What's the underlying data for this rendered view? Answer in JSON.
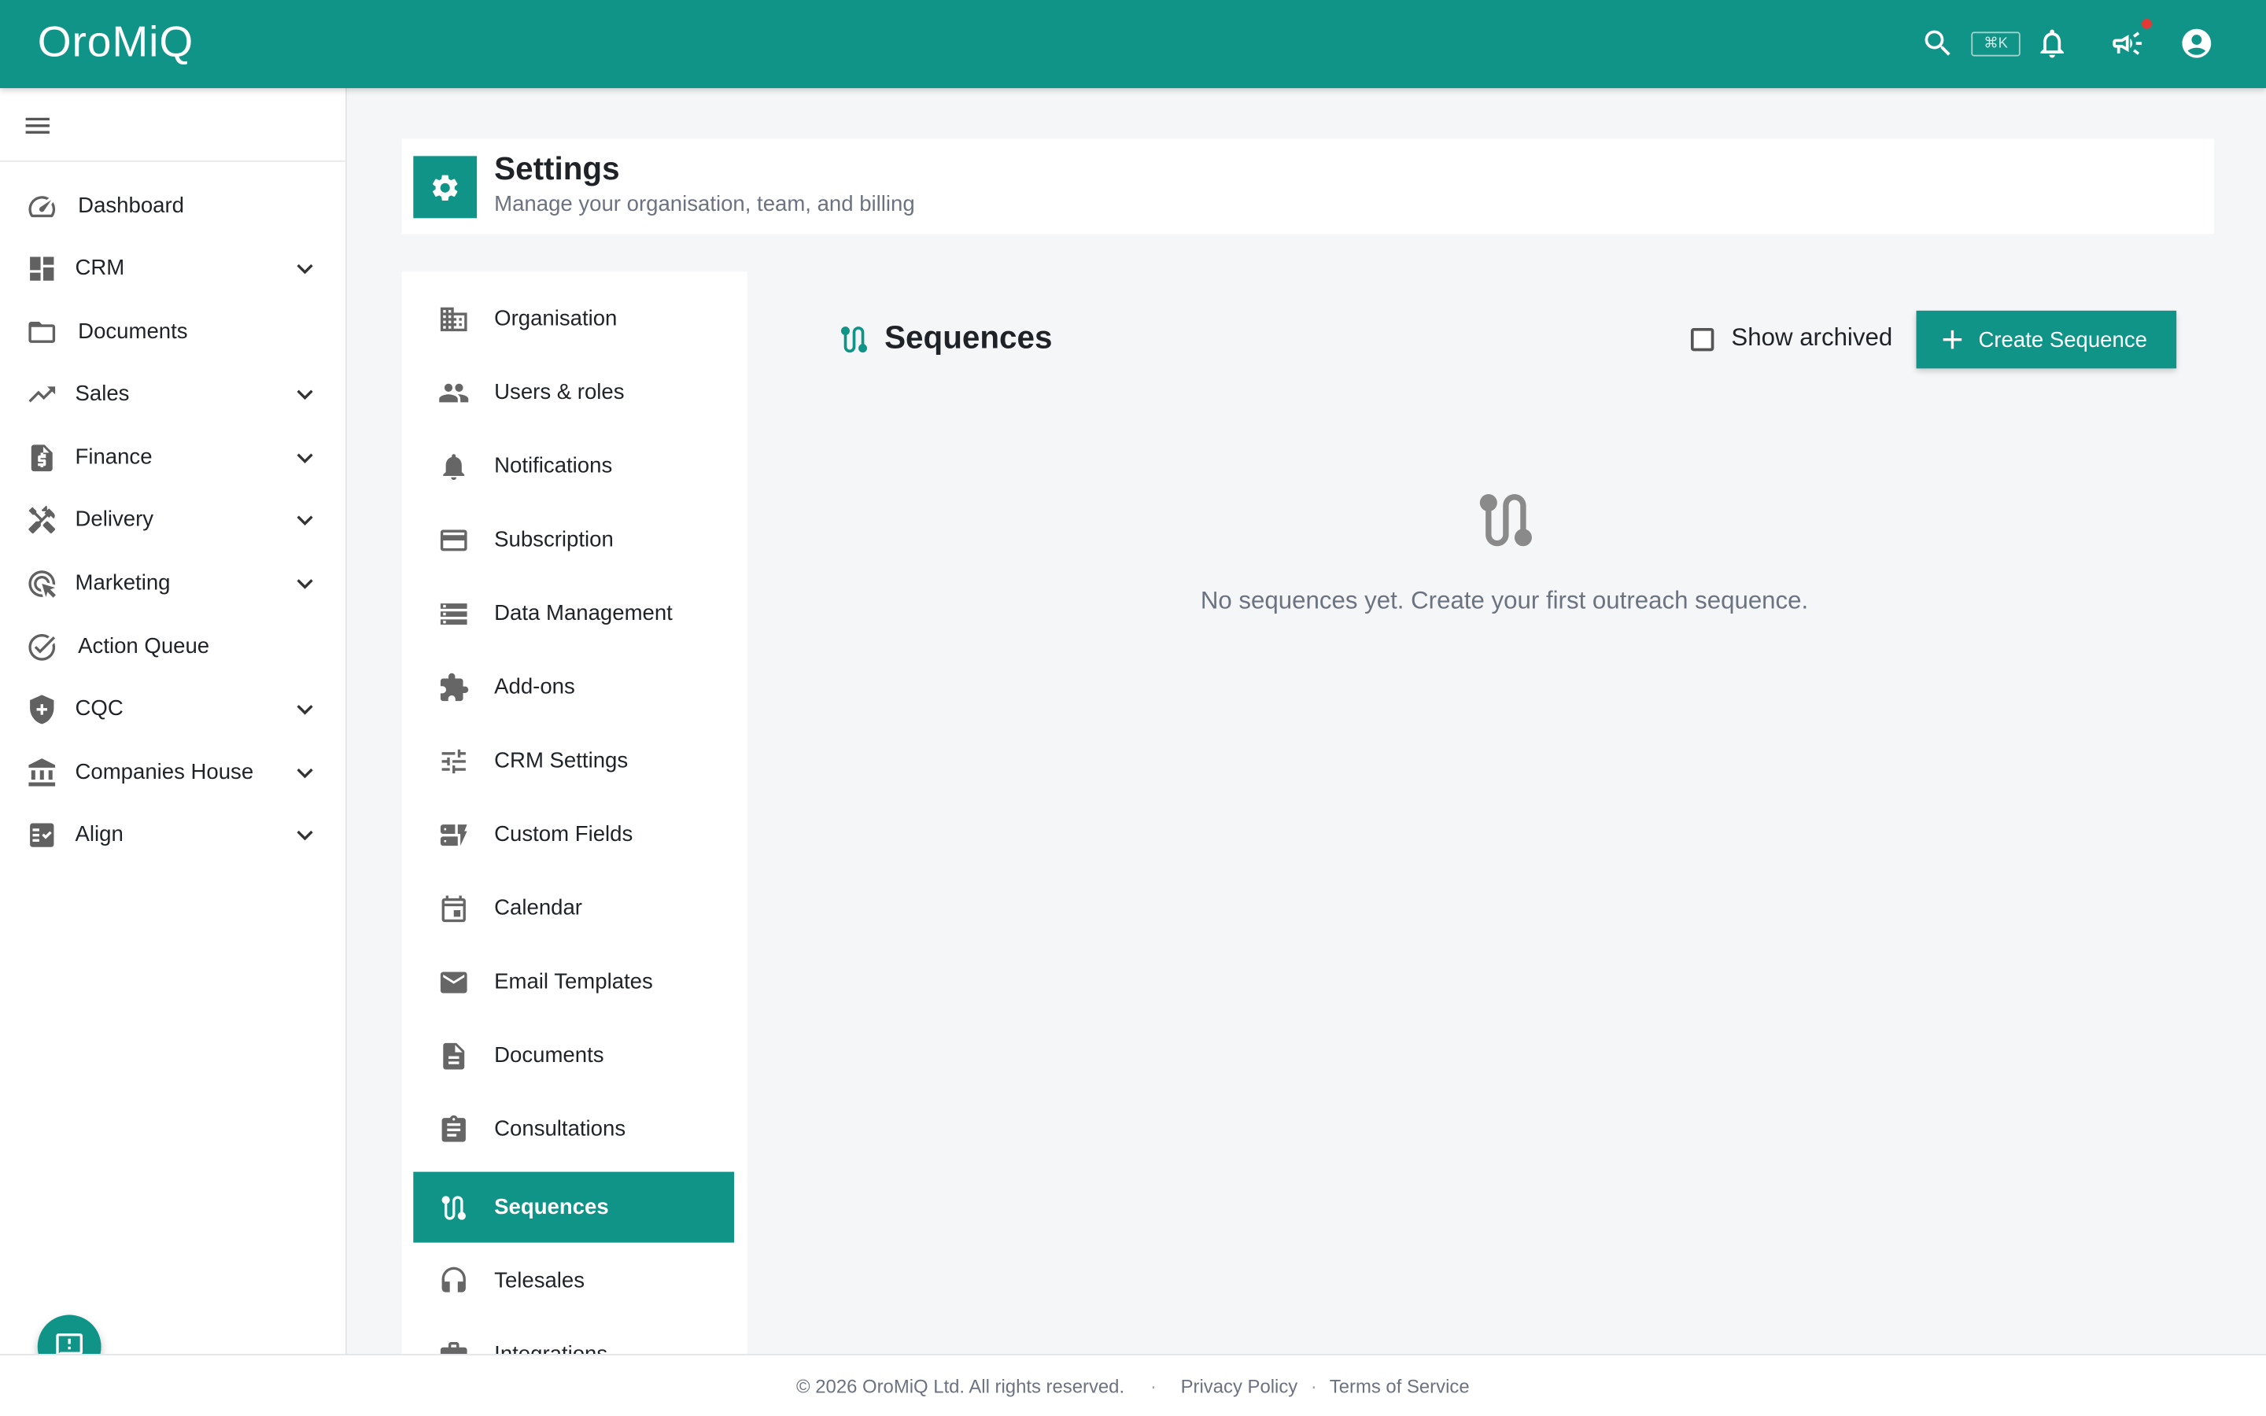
{
  "colors": {
    "accent": "#109488",
    "notification_dot": "#e53935"
  },
  "brand": {
    "name": "OroMiQ"
  },
  "topbar": {
    "search_icon": "search-icon",
    "shortcut": "⌘K",
    "icons": [
      "search-icon",
      "bell-icon",
      "megaphone-icon",
      "account-icon"
    ]
  },
  "sidebar": {
    "items": [
      {
        "label": "Dashboard",
        "icon": "speedometer-icon",
        "expandable": false
      },
      {
        "label": "CRM",
        "icon": "dashboard-grid-icon",
        "expandable": true
      },
      {
        "label": "Documents",
        "icon": "folder-icon",
        "expandable": false
      },
      {
        "label": "Sales",
        "icon": "trending-up-icon",
        "expandable": true
      },
      {
        "label": "Finance",
        "icon": "invoice-icon",
        "expandable": true
      },
      {
        "label": "Delivery",
        "icon": "tools-icon",
        "expandable": true
      },
      {
        "label": "Marketing",
        "icon": "ads-click-icon",
        "expandable": true
      },
      {
        "label": "Action Queue",
        "icon": "check-circle-icon",
        "expandable": false
      },
      {
        "label": "CQC",
        "icon": "shield-plus-icon",
        "expandable": true
      },
      {
        "label": "Companies House",
        "icon": "bank-icon",
        "expandable": true
      },
      {
        "label": "Align",
        "icon": "checklist-icon",
        "expandable": true
      }
    ]
  },
  "header": {
    "title": "Settings",
    "subtitle": "Manage your organisation, team, and billing"
  },
  "settings_menu": {
    "items": [
      {
        "label": "Organisation",
        "icon": "building-icon"
      },
      {
        "label": "Users & roles",
        "icon": "people-icon"
      },
      {
        "label": "Notifications",
        "icon": "bell-icon"
      },
      {
        "label": "Subscription",
        "icon": "credit-card-icon"
      },
      {
        "label": "Data Management",
        "icon": "storage-icon"
      },
      {
        "label": "Add-ons",
        "icon": "puzzle-icon"
      },
      {
        "label": "CRM Settings",
        "icon": "tune-icon"
      },
      {
        "label": "Custom Fields",
        "icon": "dynamic-form-icon"
      },
      {
        "label": "Calendar",
        "icon": "calendar-icon"
      },
      {
        "label": "Email Templates",
        "icon": "mail-icon"
      },
      {
        "label": "Documents",
        "icon": "document-icon"
      },
      {
        "label": "Consultations",
        "icon": "clipboard-icon"
      },
      {
        "label": "Sequences",
        "icon": "route-icon",
        "active": true
      },
      {
        "label": "Telesales",
        "icon": "headset-icon"
      },
      {
        "label": "Integrations",
        "icon": "integration-icon"
      }
    ]
  },
  "main": {
    "title": "Sequences",
    "show_archived_label": "Show archived",
    "show_archived_checked": false,
    "create_button_label": "Create Sequence",
    "empty_message": "No sequences yet. Create your first outreach sequence."
  },
  "footer": {
    "copyright": "© 2026 OroMiQ Ltd. All rights reserved.",
    "separator": "·",
    "privacy": "Privacy Policy",
    "terms": "Terms of Service"
  }
}
